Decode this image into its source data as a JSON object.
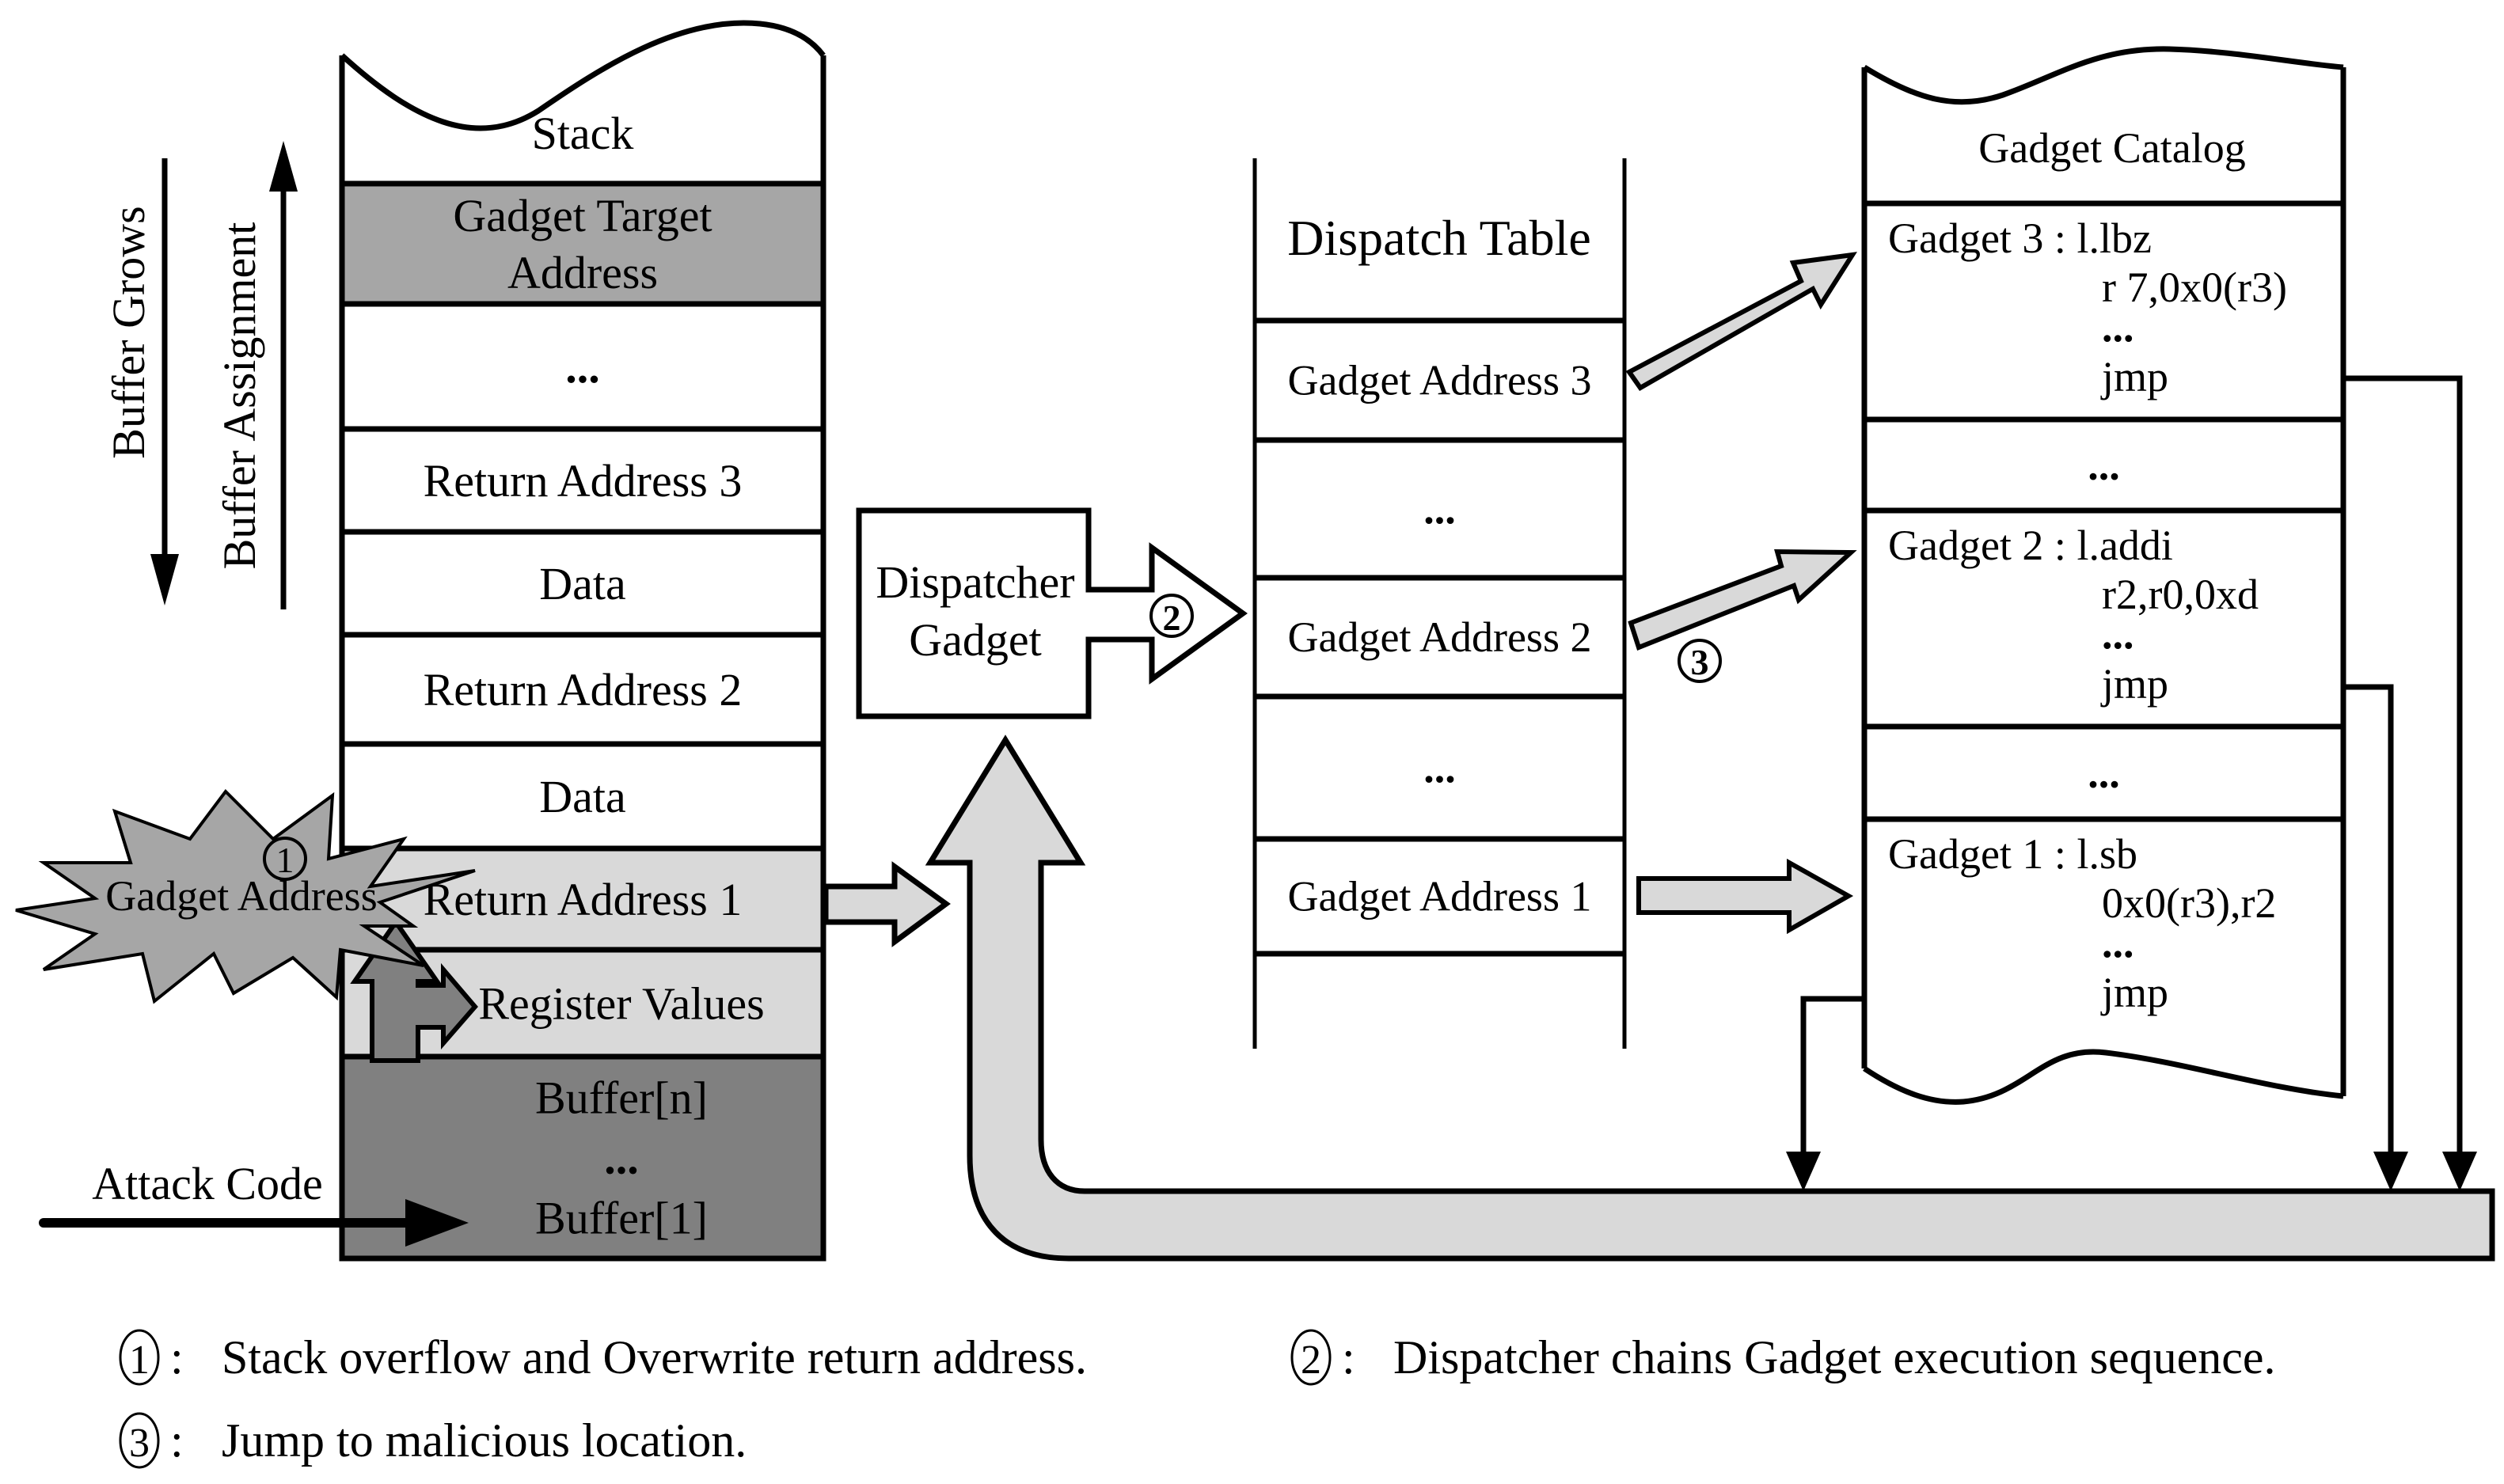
{
  "colors": {
    "light_gray": "#d9d9d9",
    "mid_gray": "#a6a6a6",
    "dark_gray": "#808080",
    "stroke": "#000000",
    "background": "#ffffff"
  },
  "side_labels": {
    "buffer_grows": "Buffer Grows",
    "buffer_assignment": "Buffer Assignment",
    "attack_code": "Attack Code"
  },
  "stack": {
    "title": "Stack",
    "rows": [
      {
        "label": "Gadget Target Address",
        "lines": [
          "Gadget Target",
          "Address"
        ],
        "fill": "mid_gray"
      },
      {
        "label": "...",
        "lines": [
          "..."
        ],
        "fill": "white"
      },
      {
        "label": "Return Address 3",
        "lines": [
          "Return Address 3"
        ],
        "fill": "white"
      },
      {
        "label": "Data",
        "lines": [
          "Data"
        ],
        "fill": "white"
      },
      {
        "label": "Return Address 2",
        "lines": [
          "Return Address 2"
        ],
        "fill": "white"
      },
      {
        "label": "Data",
        "lines": [
          "Data"
        ],
        "fill": "white"
      },
      {
        "label": "Return Address 1",
        "lines": [
          "Return Address 1"
        ],
        "fill": "light_gray"
      },
      {
        "label": "Register Values",
        "lines": [
          "Register Values"
        ],
        "fill": "light_gray"
      },
      {
        "label": "Buffer",
        "lines": [
          "Buffer[n]",
          "...",
          "Buffer[1]"
        ],
        "fill": "dark_gray"
      }
    ]
  },
  "burst": {
    "step": "①",
    "label": "Gadget Address"
  },
  "dispatcher": {
    "lines": [
      "Dispatcher",
      "Gadget"
    ],
    "step": "②"
  },
  "dispatch_table": {
    "title": "Dispatch Table",
    "rows": [
      "Gadget Address 3",
      "...",
      "Gadget Address 2",
      "...",
      "Gadget Address 1",
      ""
    ]
  },
  "jump_step": "③",
  "gadget_catalog": {
    "title": "Gadget Catalog",
    "sections": [
      {
        "name": "Gadget 3",
        "lines": [
          "Gadget 3 : l.lbz",
          "r 7,0x0(r3)",
          "...",
          "jmp"
        ]
      },
      {
        "name": "gap",
        "lines": [
          "..."
        ]
      },
      {
        "name": "Gadget 2",
        "lines": [
          "Gadget 2 : l.addi",
          "r2,r0,0xd",
          "...",
          "jmp"
        ]
      },
      {
        "name": "gap",
        "lines": [
          "..."
        ]
      },
      {
        "name": "Gadget 1",
        "lines": [
          "Gadget 1 : l.sb",
          "0x0(r3),r2",
          "...",
          "jmp"
        ]
      }
    ]
  },
  "legend": [
    {
      "mark": "①",
      "text": "Stack overflow and Overwrite return address."
    },
    {
      "mark": "②",
      "text": "Dispatcher chains Gadget execution sequence."
    },
    {
      "mark": "③",
      "text": "Jump to malicious location."
    }
  ]
}
